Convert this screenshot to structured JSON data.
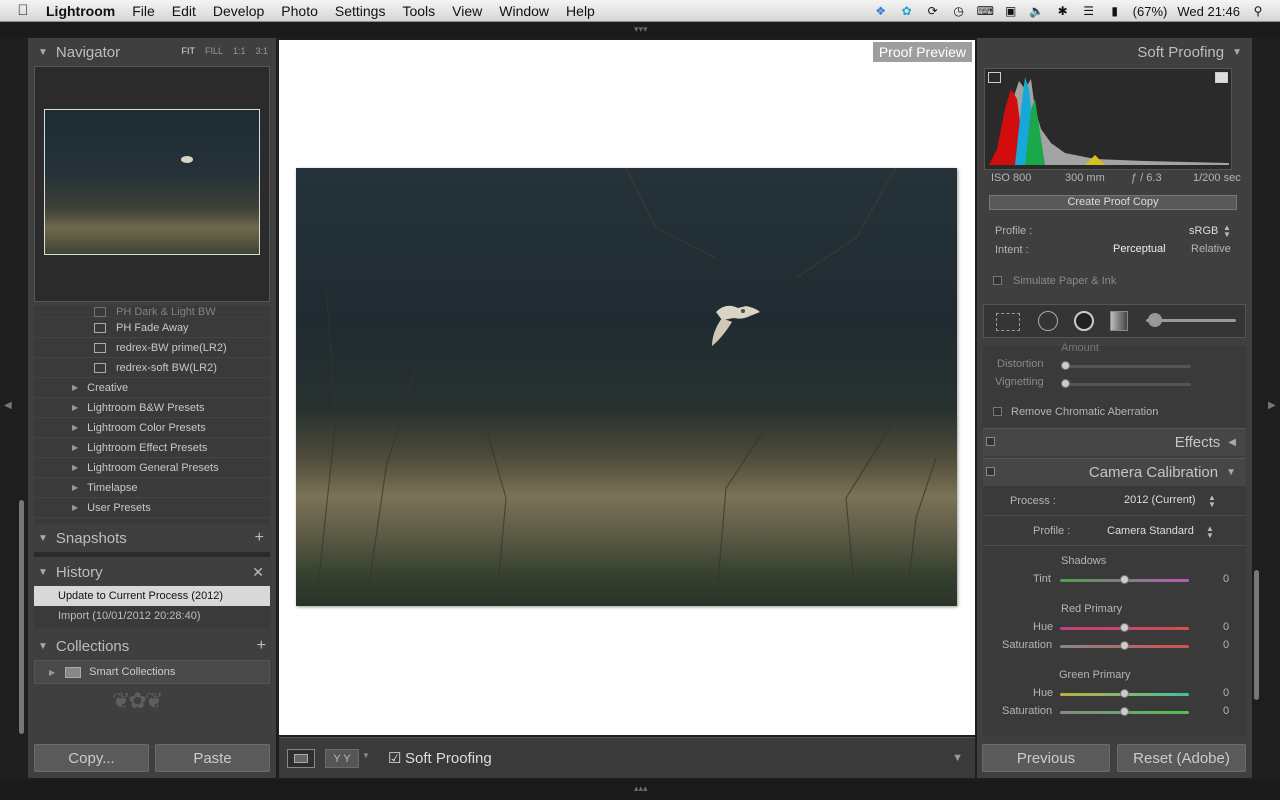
{
  "menubar": {
    "app": "Lightroom",
    "items": [
      "File",
      "Edit",
      "Develop",
      "Photo",
      "Settings",
      "Tools",
      "View",
      "Window",
      "Help"
    ],
    "battery": "(67%)",
    "clock": "Wed 21:46"
  },
  "navigator": {
    "title": "Navigator",
    "options": [
      "FIT",
      "FILL",
      "1:1",
      "3:1"
    ]
  },
  "presets": {
    "items": [
      "PH Dark & Light BW",
      "PH Fade Away",
      "redrex-BW prime(LR2)",
      "redrex-soft BW(LR2)"
    ],
    "folders": [
      "Creative",
      "Lightroom B&W Presets",
      "Lightroom Color Presets",
      "Lightroom Effect Presets",
      "Lightroom General Presets",
      "Timelapse",
      "User Presets"
    ]
  },
  "snapshots": {
    "title": "Snapshots"
  },
  "history": {
    "title": "History",
    "items": [
      "Update to Current Process (2012)",
      "Import (10/01/2012 20:28:40)"
    ]
  },
  "collections": {
    "title": "Collections",
    "items": [
      "Smart Collections"
    ]
  },
  "left_buttons": {
    "copy": "Copy...",
    "paste": "Paste"
  },
  "canvas": {
    "proof_label": "Proof Preview"
  },
  "toolbar": {
    "soft_proofing": "Soft Proofing"
  },
  "soft_proofing": {
    "title": "Soft Proofing",
    "iso": "ISO 800",
    "focal": "300 mm",
    "aperture": "ƒ / 6.3",
    "shutter": "1/200 sec",
    "create_copy": "Create Proof Copy",
    "profile_label": "Profile :",
    "profile_value": "sRGB",
    "intent_label": "Intent :",
    "intent_perceptual": "Perceptual",
    "intent_relative": "Relative",
    "simulate": "Simulate Paper & Ink"
  },
  "lens": {
    "amount": "Amount",
    "distortion": "Distortion",
    "vignetting": "Vignetting",
    "remove_ca": "Remove Chromatic Aberration"
  },
  "effects": {
    "title": "Effects"
  },
  "calibration": {
    "title": "Camera Calibration",
    "process_label": "Process :",
    "process_value": "2012 (Current)",
    "profile_label": "Profile :",
    "profile_value": "Camera Standard",
    "shadows": "Shadows",
    "tint": "Tint",
    "red_primary": "Red Primary",
    "green_primary": "Green Primary",
    "hue": "Hue",
    "saturation": "Saturation",
    "zero": "0"
  },
  "right_buttons": {
    "previous": "Previous",
    "reset": "Reset (Adobe)"
  },
  "colors": {
    "panel": "#3f3f3f",
    "canvas": "#ffffff",
    "selected_row": "#d8d8d8"
  }
}
